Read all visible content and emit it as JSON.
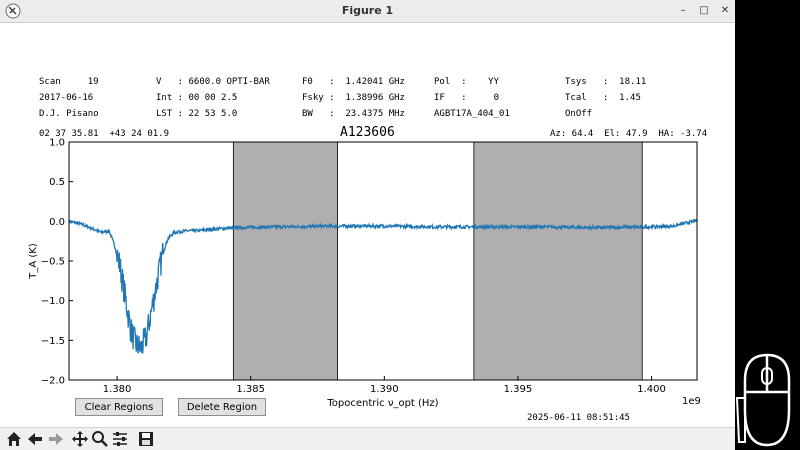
{
  "window": {
    "title": "Figure 1",
    "controls": {
      "minimize": "–",
      "maximize": "□",
      "close": "✕"
    }
  },
  "header": {
    "col1": [
      "Scan     19",
      "2017-06-16",
      "D.J. Pisano"
    ],
    "col2": [
      "V   : 6600.0 OPTI-BAR",
      "Int : 00 00 2.5",
      "LST : 22 53 5.0"
    ],
    "col3": [
      "F0   :  1.42041 GHz",
      "Fsky :  1.38996 GHz",
      "BW   :  23.4375 MHz"
    ],
    "col4": [
      "Pol  :    YY",
      "IF   :     0",
      "AGBT17A_404_01"
    ],
    "col5": [
      "Tsys   :  18.11",
      "Tcal   :  1.45",
      "OnOff"
    ],
    "coords": "02 37 35.81  +43 24 01.9",
    "source": "A123606",
    "azel": "Az: 64.4  El: 47.9  HA: -3.74"
  },
  "chart_data": {
    "type": "line",
    "title": "A123606",
    "xlabel": "Topocentric ν_opt (Hz)",
    "ylabel": "T_A (K)",
    "xlim": [
      1378200000.0,
      1401700000.0
    ],
    "ylim": [
      -2.0,
      1.0
    ],
    "x_ticks": [
      1380000000.0,
      1385000000.0,
      1390000000.0,
      1395000000.0,
      1400000000.0
    ],
    "x_tick_labels": [
      "1.380",
      "1.385",
      "1.390",
      "1.395",
      "1.400"
    ],
    "y_ticks": [
      1.0,
      0.5,
      0.0,
      -0.5,
      -1.0,
      -1.5,
      -2.0
    ],
    "y_tick_labels": [
      "1.0",
      "0.5",
      "0.0",
      "−0.5",
      "−1.0",
      "−1.5",
      "−2.0"
    ],
    "offset_label": "1e9",
    "grid": false,
    "line_color": "#1f77b4",
    "region_color": "#b0aeb0",
    "regions": [
      [
        1384350000.0,
        1388250000.0
      ],
      [
        1393350000.0,
        1399650000.0
      ]
    ],
    "series": [
      {
        "x": [
          1378200000.0,
          1378600000.0,
          1379000000.0,
          1379400000.0,
          1379700000.0,
          1379900000.0,
          1380100000.0,
          1380300000.0,
          1380500000.0,
          1380700000.0,
          1380900000.0,
          1381100000.0,
          1381300000.0,
          1381500000.0,
          1381700000.0,
          1381900000.0,
          1382100000.0,
          1382300000.0,
          1382600000.0,
          1383000000.0,
          1383500000.0,
          1384000000.0,
          1384500000.0,
          1386000000.0,
          1388000000.0,
          1390000000.0,
          1392000000.0,
          1394000000.0,
          1396000000.0,
          1398000000.0,
          1400000000.0,
          1400800000.0,
          1401700000.0
        ],
        "y": [
          0.0,
          -0.03,
          -0.08,
          -0.14,
          -0.12,
          -0.3,
          -0.55,
          -0.95,
          -1.35,
          -1.55,
          -1.6,
          -1.45,
          -1.1,
          -0.75,
          -0.42,
          -0.22,
          -0.15,
          -0.13,
          -0.12,
          -0.12,
          -0.1,
          -0.09,
          -0.08,
          -0.07,
          -0.06,
          -0.06,
          -0.07,
          -0.07,
          -0.07,
          -0.08,
          -0.07,
          -0.06,
          0.01
        ]
      }
    ]
  },
  "buttons": {
    "clear_regions": "Clear Regions",
    "delete_region": "Delete Region"
  },
  "timestamp": "2025-06-11 08:51:45",
  "toolbar": {
    "home_icon": "home-icon",
    "back_icon": "arrow-left-icon",
    "forward_icon": "arrow-right-icon",
    "pan_icon": "move-icon",
    "zoom_icon": "magnifier-icon",
    "configure_icon": "sliders-icon",
    "save_icon": "floppy-disk-icon"
  }
}
